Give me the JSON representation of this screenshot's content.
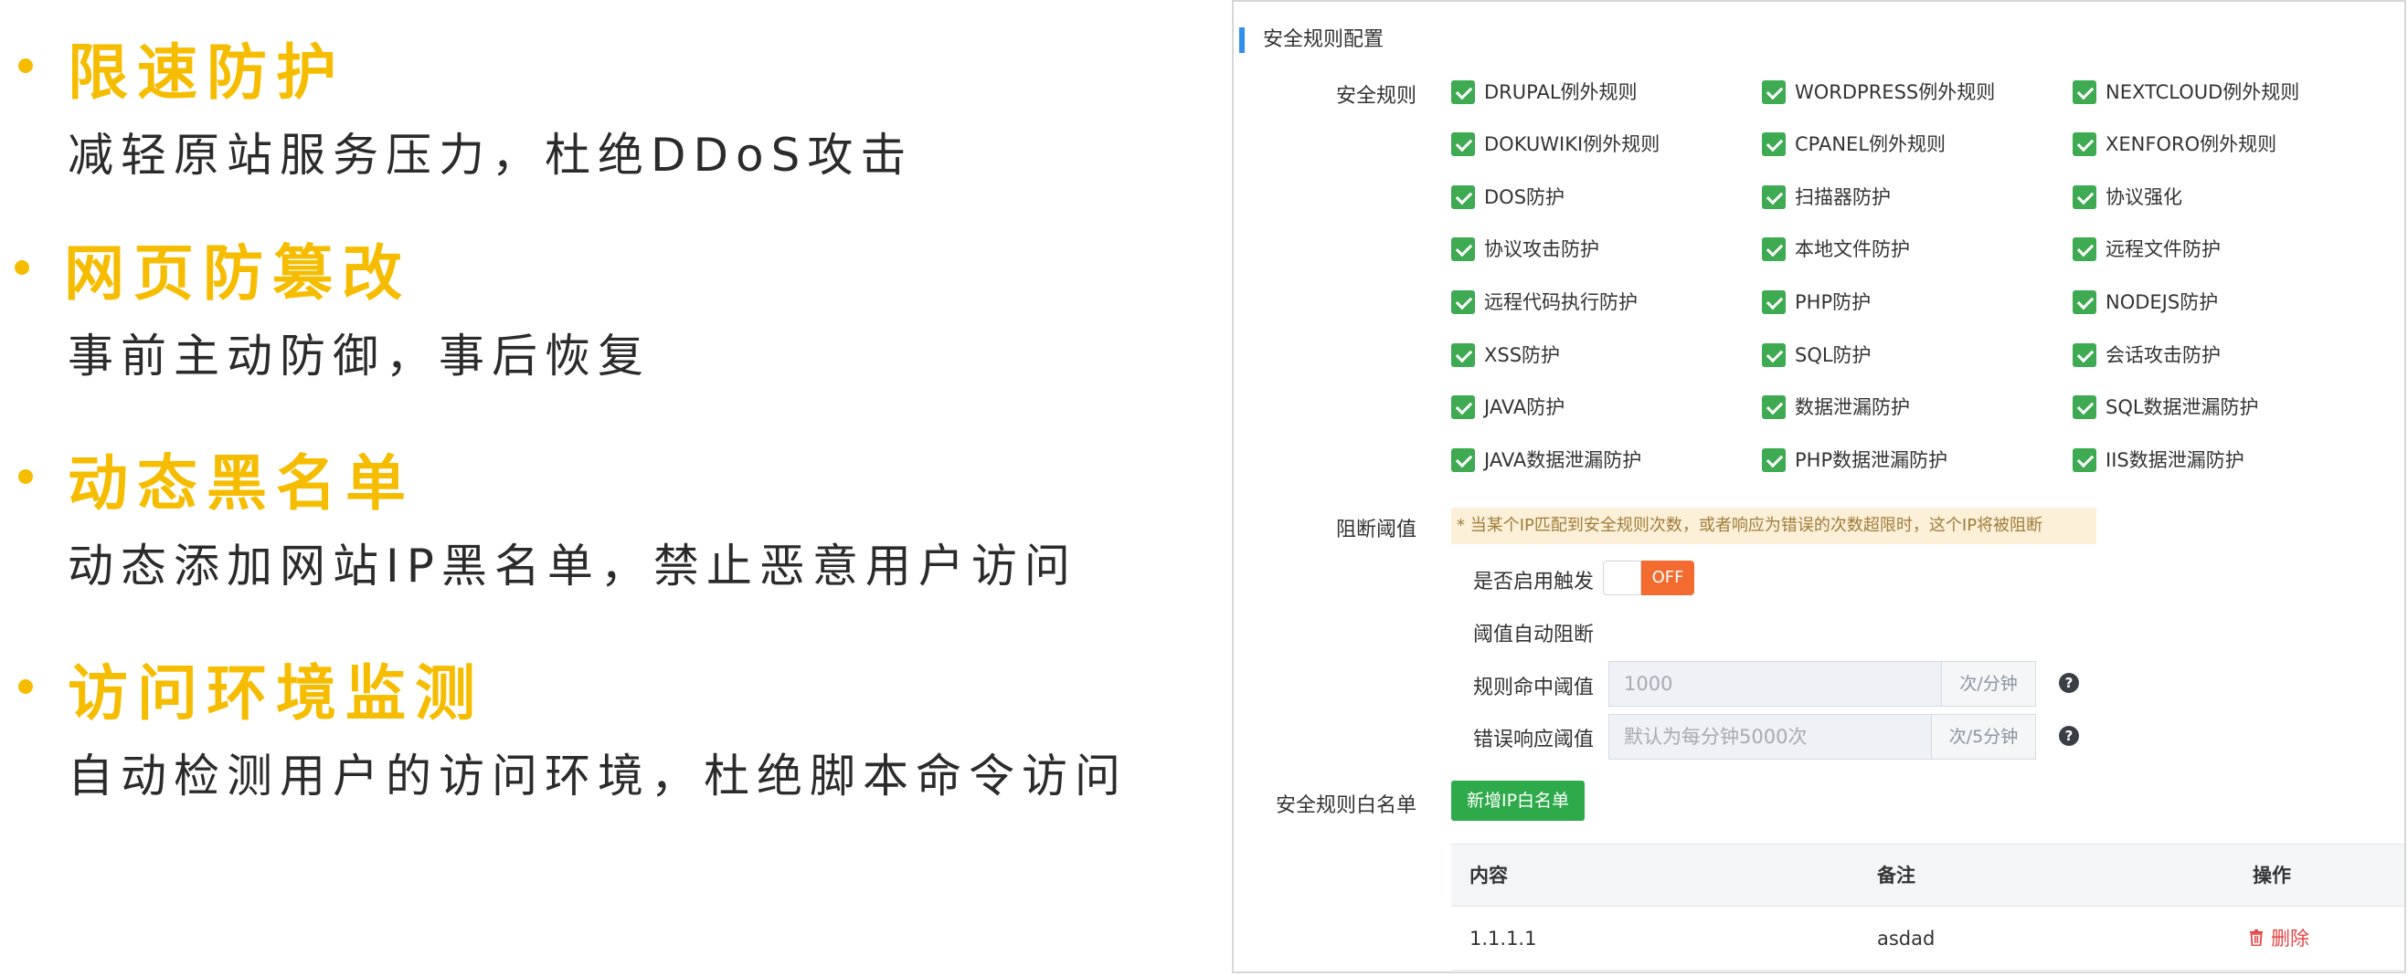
{
  "features": [
    {
      "title": "限速防护",
      "desc": "减轻原站服务压力，杜绝DDoS攻击"
    },
    {
      "title": "网页防篡改",
      "desc": "事前主动防御，事后恢复"
    },
    {
      "title": "动态黑名单",
      "desc": "动态添加网站IP黑名单，禁止恶意用户访问"
    },
    {
      "title": "访问环境监测",
      "desc": "自动检测用户的访问环境，杜绝脚本命令访问"
    }
  ],
  "panel": {
    "section_title": "安全规则配置",
    "rules_label": "安全规则",
    "rules": [
      {
        "label": "DRUPAL例外规则",
        "checked": true
      },
      {
        "label": "WORDPRESS例外规则",
        "checked": true
      },
      {
        "label": "NEXTCLOUD例外规则",
        "checked": true
      },
      {
        "label": "DOKUWIKI例外规则",
        "checked": true
      },
      {
        "label": "CPANEL例外规则",
        "checked": true
      },
      {
        "label": "XENFORO例外规则",
        "checked": true
      },
      {
        "label": "DOS防护",
        "checked": true
      },
      {
        "label": "扫描器防护",
        "checked": true
      },
      {
        "label": "协议强化",
        "checked": true
      },
      {
        "label": "协议攻击防护",
        "checked": true
      },
      {
        "label": "本地文件防护",
        "checked": true
      },
      {
        "label": "远程文件防护",
        "checked": true
      },
      {
        "label": "远程代码执行防护",
        "checked": true
      },
      {
        "label": "PHP防护",
        "checked": true
      },
      {
        "label": "NODEJS防护",
        "checked": true
      },
      {
        "label": "XSS防护",
        "checked": true
      },
      {
        "label": "SQL防护",
        "checked": true
      },
      {
        "label": "会话攻击防护",
        "checked": true
      },
      {
        "label": "JAVA防护",
        "checked": true
      },
      {
        "label": "数据泄漏防护",
        "checked": true
      },
      {
        "label": "SQL数据泄漏防护",
        "checked": true
      },
      {
        "label": "JAVA数据泄漏防护",
        "checked": true
      },
      {
        "label": "PHP数据泄漏防护",
        "checked": true
      },
      {
        "label": "IIS数据泄漏防护",
        "checked": true
      }
    ],
    "block_label": "阻断阈值",
    "block_notice": "* 当某个IP匹配到安全规则次数，或者响应为错误的次数超限时，这个IP将被阻断",
    "enable_trigger_label": "是否启用触发",
    "toggle_text": "OFF",
    "auto_block_label": "阈值自动阻断",
    "rule_hit_label": "规则命中阈值",
    "rule_hit_value": "1000",
    "rule_hit_unit": "次/分钟",
    "error_resp_label": "错误响应阈值",
    "error_resp_placeholder": "默认为每分钟5000次",
    "error_resp_unit": "次/5分钟",
    "help_glyph": "?",
    "whitelist_label": "安全规则白名单",
    "add_ip_button": "新增IP白名单",
    "table": {
      "headers": [
        "内容",
        "备注",
        "操作"
      ],
      "rows": [
        {
          "content": "1.1.1.1",
          "note": "asdad",
          "action": "删除"
        }
      ]
    }
  },
  "colors": {
    "accent_yellow": "#f6bd00",
    "checkbox_green": "#3eaa52",
    "button_green": "#2faa4a",
    "toggle_orange": "#f36b2f",
    "section_blue": "#2f8ff0",
    "delete_red": "#e64545"
  }
}
